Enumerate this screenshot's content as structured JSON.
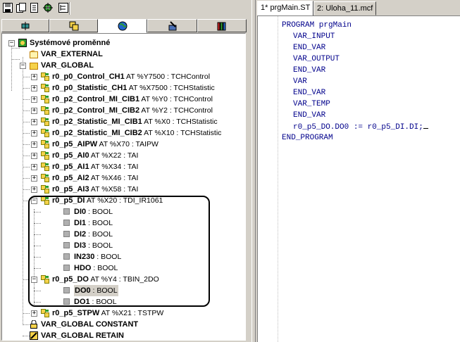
{
  "toolbar": {
    "buttons": [
      "save-icon",
      "copy-icon",
      "pages-icon",
      "gear-icon",
      "tree-view-icon"
    ]
  },
  "sidebar_tabs": [
    {
      "icon": "component-icon"
    },
    {
      "icon": "blocks-icon"
    },
    {
      "icon": "globe-icon",
      "active": true
    },
    {
      "icon": "tools-icon"
    },
    {
      "icon": "library-icon"
    }
  ],
  "tree": {
    "root": "Systémové proměnné",
    "var_external": "VAR_EXTERNAL",
    "var_global": "VAR_GLOBAL",
    "globals": [
      {
        "name": "r0_p0_Control_CH1",
        "at": " AT %Y7500 : TCHControl"
      },
      {
        "name": "r0_p0_Statistic_CH1",
        "at": " AT %X7500 : TCHStatistic"
      },
      {
        "name": "r0_p2_Control_MI_CIB1",
        "at": " AT %Y0 : TCHControl"
      },
      {
        "name": "r0_p2_Control_MI_CIB2",
        "at": " AT %Y2 : TCHControl"
      },
      {
        "name": "r0_p2_Statistic_MI_CIB1",
        "at": " AT %X0 : TCHStatistic"
      },
      {
        "name": "r0_p2_Statistic_MI_CIB2",
        "at": " AT %X10 : TCHStatistic"
      },
      {
        "name": "r0_p5_AIPW",
        "at": " AT %X70 : TAIPW"
      },
      {
        "name": "r0_p5_AI0",
        "at": " AT %X22 : TAI"
      },
      {
        "name": "r0_p5_AI1",
        "at": " AT %X34 : TAI"
      },
      {
        "name": "r0_p5_AI2",
        "at": " AT %X46 : TAI"
      },
      {
        "name": "r0_p5_AI3",
        "at": " AT %X58 : TAI"
      }
    ],
    "di": {
      "name": "r0_p5_DI",
      "at": " AT %X20 : TDI_IR1061"
    },
    "di_children": [
      {
        "name": "DI0",
        "type": " : BOOL"
      },
      {
        "name": "DI1",
        "type": " : BOOL"
      },
      {
        "name": "DI2",
        "type": " : BOOL"
      },
      {
        "name": "DI3",
        "type": " : BOOL"
      },
      {
        "name": "IN230",
        "type": " : BOOL"
      },
      {
        "name": "HDO",
        "type": " : BOOL"
      }
    ],
    "do": {
      "name": "r0_p5_DO",
      "at": " AT %Y4 : TBIN_2DO"
    },
    "do_children": [
      {
        "name": "DO0",
        "type": " : BOOL",
        "selected": true
      },
      {
        "name": "DO1",
        "type": " : BOOL"
      }
    ],
    "stpw": {
      "name": "r0_p5_STPW",
      "at": " AT %X21 : TSTPW"
    },
    "var_global_constant": "VAR_GLOBAL CONSTANT",
    "var_global_retain": "VAR_GLOBAL RETAIN"
  },
  "doc_tabs": [
    "1* prgMain.ST",
    "2: Uloha_11.mcf"
  ],
  "code_lines": [
    "PROGRAM prgMain",
    "VAR_INPUT",
    "END_VAR",
    "VAR_OUTPUT",
    "END_VAR",
    "VAR",
    "END_VAR",
    "VAR_TEMP",
    "END_VAR",
    "r0_p5_DO.DO0 := r0_p5_DI.DI;",
    "END_PROGRAM"
  ],
  "colors": {
    "code_text": "#00008b",
    "folder": "#f5d24a",
    "tree_bg": "#ffffff",
    "chrome": "#d4d0c8"
  }
}
